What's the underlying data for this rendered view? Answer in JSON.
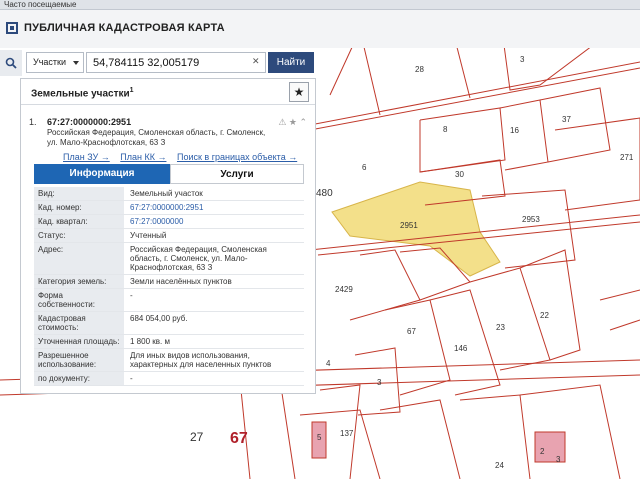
{
  "browser": {
    "tab_label": "Часто посещаемые"
  },
  "app": {
    "title": "ПУБЛИЧНАЯ КАДАСТРОВАЯ КАРТА"
  },
  "search": {
    "category": "Участки",
    "query": "54,784115 32,005179",
    "clear_label": "✕",
    "find_label": "Найти"
  },
  "panel": {
    "title": "Земельные участки",
    "title_sup": "1",
    "fav_icon": "star-icon",
    "result": {
      "num": "1.",
      "id": "67:27:0000000:2951",
      "address": "Российская Федерация, Смоленская область, г. Смоленск, ул. Мало-Краснофлотская, 63 З",
      "tools": "⚠ ★ ⌃",
      "links": [
        "План ЗУ →",
        "План КК →",
        "Поиск в границах объекта →"
      ]
    },
    "tabs": {
      "info": "Информация",
      "services": "Услуги"
    },
    "rows": [
      {
        "k": "Вид:",
        "v": "Земельный участок",
        "link": false
      },
      {
        "k": "Кад. номер:",
        "v": "67:27:0000000:2951",
        "link": true
      },
      {
        "k": "Кад. квартал:",
        "v": "67:27:0000000",
        "link": true
      },
      {
        "k": "Статус:",
        "v": "Учтенный",
        "link": false
      },
      {
        "k": "Адрес:",
        "v": "Российская Федерация, Смоленская область, г. Смоленск, ул. Мало-Краснофлотская, 63 З",
        "link": false
      },
      {
        "k": "Категория земель:",
        "v": "Земли населённых пунктов",
        "link": false
      },
      {
        "k": "Форма собственности:",
        "v": "-",
        "link": false
      },
      {
        "k": "Кадастровая стоимость:",
        "v": "684 054,00 руб.",
        "link": false
      },
      {
        "k": "Уточненная площадь:",
        "v": "1 800 кв. м",
        "link": false
      },
      {
        "k": "Разрешенное использование:",
        "v": "Для иных видов использования, характерных для населенных пунктов",
        "link": false
      },
      {
        "k": "по документу:",
        "v": "-",
        "link": false
      }
    ]
  },
  "map": {
    "labels": [
      "28",
      "3",
      "8",
      "16",
      "37",
      "271",
      "30",
      "6",
      "480",
      "2951",
      "2953",
      "2429",
      "67",
      "146",
      "23",
      "22",
      "4",
      "3",
      "27",
      "67",
      "5",
      "137",
      "24",
      "2",
      "3"
    ],
    "highlight_color": "#f3e08a",
    "boundary_color": "#c0392b"
  }
}
